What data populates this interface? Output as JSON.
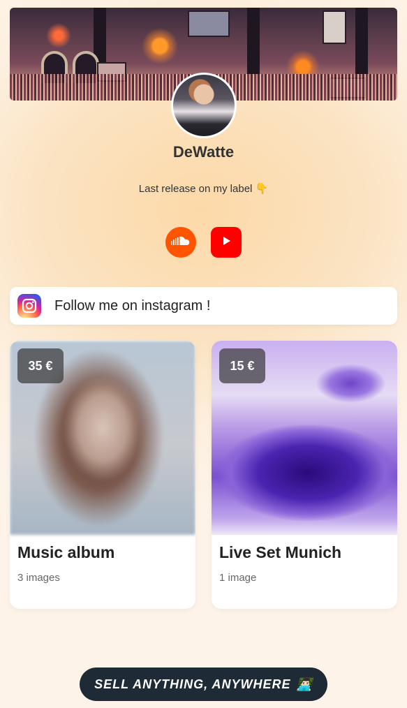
{
  "profile": {
    "name": "DeWatte",
    "bio": "Last release on my label 👇"
  },
  "socials": [
    {
      "name": "SoundCloud",
      "icon": "soundcloud-icon",
      "color": "#ff5500"
    },
    {
      "name": "YouTube",
      "icon": "youtube-icon",
      "color": "#ff0000"
    }
  ],
  "links": [
    {
      "label": "Follow me on instagram !",
      "icon": "instagram-icon"
    }
  ],
  "products": [
    {
      "price": "35 €",
      "title": "Music album",
      "subtitle": "3 images"
    },
    {
      "price": "15 €",
      "title": "Live Set Munich",
      "subtitle": "1 image"
    }
  ],
  "cta": {
    "label": "SELL ANYTHING, ANYWHERE",
    "emoji": "👨🏻‍💻"
  }
}
